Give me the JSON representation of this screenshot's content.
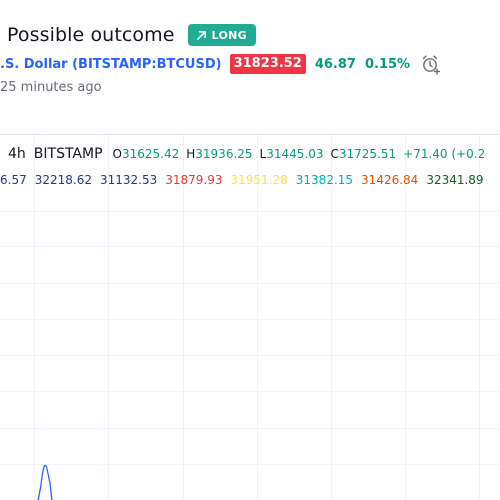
{
  "header": {
    "title": "Possible outcome",
    "badge_label": "LONG",
    "symbol_text": ".S. Dollar (BITSTAMP:BTCUSD)",
    "price": "31823.52",
    "change_abs": "46.87",
    "change_pct": "0.15%",
    "time_ago": "25 minutes ago"
  },
  "chart": {
    "interval": "4h",
    "exchange": "BITSTAMP",
    "ohlc": [
      {
        "label": "O",
        "value": "31625.42"
      },
      {
        "label": "H",
        "value": "31936.25"
      },
      {
        "label": "L",
        "value": "31445.03"
      },
      {
        "label": "C",
        "value": "31725.51"
      }
    ],
    "change": "+71.40 (+0.2",
    "indicators": [
      {
        "value": "6.57",
        "color": "#1e3a8a"
      },
      {
        "value": "32218.62",
        "color": "#1e3a8a"
      },
      {
        "value": "31132.53",
        "color": "#1e3a8a"
      },
      {
        "value": "31879.93",
        "color": "#e53935"
      },
      {
        "value": "31951.28",
        "color": "#fbe34a"
      },
      {
        "value": "31382.15",
        "color": "#00acc1"
      },
      {
        "value": "31426.84",
        "color": "#e65100"
      },
      {
        "value": "32341.89",
        "color": "#1b5e20"
      }
    ]
  },
  "colors": {
    "long": "#22ab94",
    "price_box": "#f23645",
    "positive": "#089981",
    "link": "#2962ff",
    "muted": "#6a6d78"
  }
}
